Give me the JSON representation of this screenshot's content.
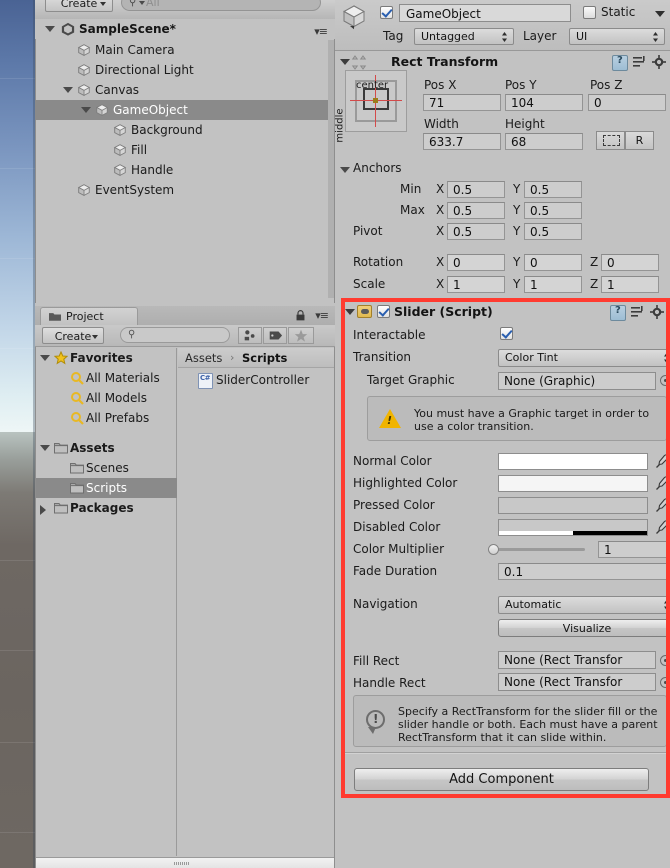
{
  "scene_view": {
    "name": "scene-view-sliver"
  },
  "hierarchy": {
    "create_label": "Create",
    "search_placeholder": "All",
    "scene_name": "SampleScene*",
    "items": [
      {
        "label": "Main Camera",
        "depth": 1,
        "foldout": "none",
        "selected": false
      },
      {
        "label": "Directional Light",
        "depth": 1,
        "foldout": "none",
        "selected": false
      },
      {
        "label": "Canvas",
        "depth": 1,
        "foldout": "open",
        "selected": false
      },
      {
        "label": "GameObject",
        "depth": 2,
        "foldout": "open",
        "selected": true
      },
      {
        "label": "Background",
        "depth": 3,
        "foldout": "none",
        "selected": false
      },
      {
        "label": "Fill",
        "depth": 3,
        "foldout": "none",
        "selected": false
      },
      {
        "label": "Handle",
        "depth": 3,
        "foldout": "none",
        "selected": false
      },
      {
        "label": "EventSystem",
        "depth": 1,
        "foldout": "none",
        "selected": false
      }
    ]
  },
  "project": {
    "tab_label": "Project",
    "create_label": "Create",
    "search_placeholder": "",
    "tree": [
      {
        "label": "Favorites",
        "kind": "favorites",
        "depth": 0,
        "foldout": "open",
        "bold": true,
        "selected": false
      },
      {
        "label": "All Materials",
        "kind": "search",
        "depth": 1,
        "foldout": "none",
        "bold": false,
        "selected": false
      },
      {
        "label": "All Models",
        "kind": "search",
        "depth": 1,
        "foldout": "none",
        "bold": false,
        "selected": false
      },
      {
        "label": "All Prefabs",
        "kind": "search",
        "depth": 1,
        "foldout": "none",
        "bold": false,
        "selected": false
      },
      {
        "label": "Assets",
        "kind": "folder",
        "depth": 0,
        "foldout": "open",
        "bold": true,
        "selected": false
      },
      {
        "label": "Scenes",
        "kind": "folder",
        "depth": 1,
        "foldout": "none",
        "bold": false,
        "selected": false
      },
      {
        "label": "Scripts",
        "kind": "folder",
        "depth": 1,
        "foldout": "none",
        "bold": false,
        "selected": true
      },
      {
        "label": "Packages",
        "kind": "folder",
        "depth": 0,
        "foldout": "closed",
        "bold": true,
        "selected": false
      }
    ],
    "breadcrumb": {
      "root": "Assets",
      "separator": "›",
      "current": "Scripts"
    },
    "assets": [
      {
        "name": "SliderController",
        "type": "cs-script",
        "badge": "C#"
      }
    ]
  },
  "inspector": {
    "object_enabled": true,
    "object_name": "GameObject",
    "static_label": "Static",
    "static_checked": false,
    "tag_label": "Tag",
    "tag_value": "Untagged",
    "layer_label": "Layer",
    "layer_value": "UI",
    "rect_transform": {
      "title": "Rect Transform",
      "anchor_preset_top": "center",
      "anchor_preset_side": "middle",
      "pos_x_label": "Pos X",
      "pos_x": "71",
      "pos_y_label": "Pos Y",
      "pos_y": "104",
      "pos_z_label": "Pos Z",
      "pos_z": "0",
      "width_label": "Width",
      "width": "633.7",
      "height_label": "Height",
      "height": "68",
      "raw_label": "R",
      "anchors_label": "Anchors",
      "min_label": "Min",
      "min_x": "0.5",
      "min_y": "0.5",
      "max_label": "Max",
      "max_x": "0.5",
      "max_y": "0.5",
      "pivot_label": "Pivot",
      "pivot_x": "0.5",
      "pivot_y": "0.5",
      "rotation_label": "Rotation",
      "rot_x": "0",
      "rot_y": "0",
      "rot_z": "0",
      "scale_label": "Scale",
      "scale_x": "1",
      "scale_y": "1",
      "scale_z": "1",
      "axis_x": "X",
      "axis_y": "Y",
      "axis_z": "Z"
    },
    "slider": {
      "title": "Slider (Script)",
      "enabled": true,
      "interactable_label": "Interactable",
      "interactable_checked": true,
      "transition_label": "Transition",
      "transition_value": "Color Tint",
      "target_graphic_label": "Target Graphic",
      "target_graphic_value": "None (Graphic)",
      "warning_text": "You must have a Graphic target in order to use a color transition.",
      "normal_color_label": "Normal Color",
      "normal_color": "#ffffff",
      "highlighted_color_label": "Highlighted Color",
      "highlighted_color": "#f5f5f5",
      "pressed_color_label": "Pressed Color",
      "pressed_color": "#c8c8c8",
      "disabled_color_label": "Disabled Color",
      "disabled_color": "#c8c8c8",
      "color_multiplier_label": "Color Multiplier",
      "color_multiplier": "1",
      "fade_duration_label": "Fade Duration",
      "fade_duration": "0.1",
      "navigation_label": "Navigation",
      "navigation_value": "Automatic",
      "visualize_label": "Visualize",
      "fill_rect_label": "Fill Rect",
      "fill_rect_value": "None (Rect Transfor",
      "handle_rect_label": "Handle Rect",
      "handle_rect_value": "None (Rect Transfor",
      "info_text": "Specify a RectTransform for the slider fill or the slider handle or both. Each must have a parent RectTransform that it can slide within."
    },
    "add_component_label": "Add Component",
    "highlight_color": "#ff3b30"
  }
}
